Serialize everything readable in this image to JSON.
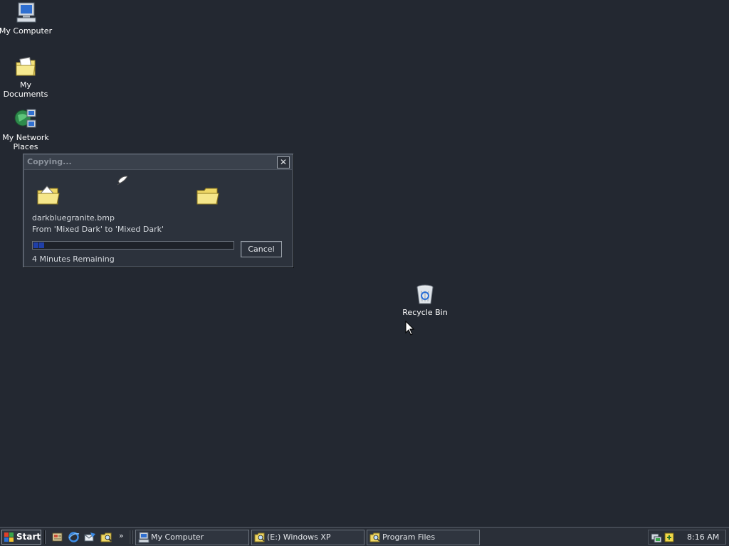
{
  "desktop": {
    "icons": [
      {
        "label": "My Computer",
        "icon": "computer-icon"
      },
      {
        "label": "My Documents",
        "icon": "documents-folder-icon"
      },
      {
        "label": "My Network Places",
        "icon": "network-places-icon"
      },
      {
        "label": "Recycle Bin",
        "icon": "recycle-bin-icon"
      }
    ]
  },
  "copy_dialog": {
    "title": "Copying...",
    "close_label": "✕",
    "file_name": "darkbluegranite.bmp",
    "from_to": "From 'Mixed Dark' to 'Mixed Dark'",
    "progress_fraction": 0.05,
    "remaining": "4 Minutes Remaining",
    "cancel_label": "Cancel"
  },
  "taskbar": {
    "start_label": "Start",
    "quick_launch": [
      "show-desktop-icon",
      "internet-explorer-icon",
      "outlook-express-icon",
      "windows-explorer-icon"
    ],
    "more_label": "»",
    "buttons": [
      {
        "label": "My Computer",
        "icon": "computer-icon"
      },
      {
        "label": "(E:) Windows XP",
        "icon": "explorer-folder-icon"
      },
      {
        "label": "Program Files",
        "icon": "explorer-folder-icon"
      }
    ],
    "tray_icons": [
      "network-tray-icon",
      "safely-remove-tray-icon"
    ],
    "clock": "8:16 AM"
  },
  "colors": {
    "desktop_background": "#232831",
    "progress_fill": "#1f3fa8",
    "folder_yellow": "#f3e27a"
  }
}
